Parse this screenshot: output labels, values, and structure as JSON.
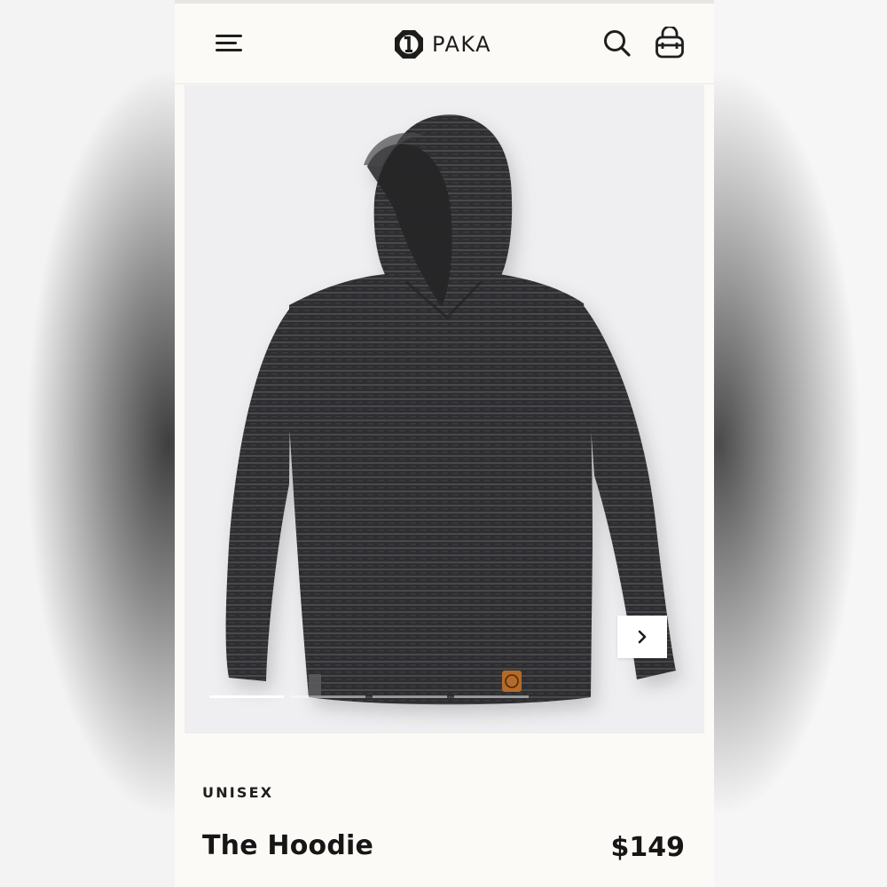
{
  "header": {
    "brand_name": "PAKA",
    "menu_icon": "hamburger-menu-icon",
    "search_icon": "search-icon",
    "bag_icon": "shopping-bag-icon"
  },
  "gallery": {
    "next_icon": "chevron-right-icon",
    "slide_count": 4,
    "active_slide": 1
  },
  "product": {
    "category": "UNISEX",
    "title": "The Hoodie",
    "price": "$149"
  },
  "colors": {
    "page_background": "#fbfaf6",
    "text": "#161616",
    "gallery_background": "#efeff1"
  }
}
